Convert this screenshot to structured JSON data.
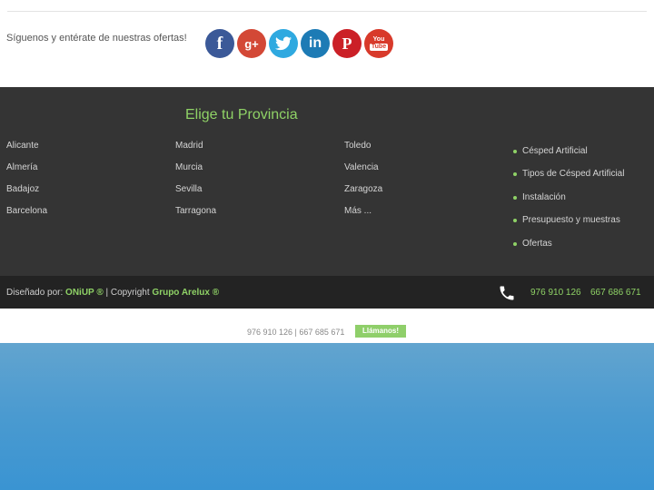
{
  "follow": {
    "text": "Síguenos y entérate de nuestras ofertas!"
  },
  "social": [
    {
      "name": "facebook-icon",
      "glyph": "f"
    },
    {
      "name": "google-plus-icon",
      "glyph": "g+"
    },
    {
      "name": "twitter-icon",
      "glyph": ""
    },
    {
      "name": "linkedin-icon",
      "glyph": "in"
    },
    {
      "name": "pinterest-icon",
      "glyph": "P"
    },
    {
      "name": "youtube-icon",
      "glyph_top": "You",
      "glyph_bottom": "Tube"
    }
  ],
  "provinces": {
    "title": "Elige tu Provincia",
    "col1": [
      "Alicante",
      "Almería",
      "Badajoz",
      "Barcelona"
    ],
    "col2": [
      "Madrid",
      "Murcia",
      "Sevilla",
      "Tarragona"
    ],
    "col3": [
      "Toledo",
      "Valencia",
      "Zaragoza",
      "Más ..."
    ]
  },
  "links": [
    "Césped Artificial",
    "Tipos de Césped Artificial",
    "Instalación",
    "Presupuesto y muestras",
    "Ofertas"
  ],
  "credit": {
    "prefix": "Diseñado por: ",
    "designer": "ONiUP ®",
    "mid": " | Copyright ",
    "company": "Grupo Arelux ®"
  },
  "phones": {
    "phone1": "976 910 126",
    "phone2": "667 686 671"
  },
  "call": {
    "numbers": "976 910 126 | 667 685 671",
    "button": "Llámanos!"
  },
  "colors": {
    "accent": "#8fd266",
    "footer_bg": "#343434",
    "bar_bg": "#232323",
    "sky": "#3a94d2"
  }
}
